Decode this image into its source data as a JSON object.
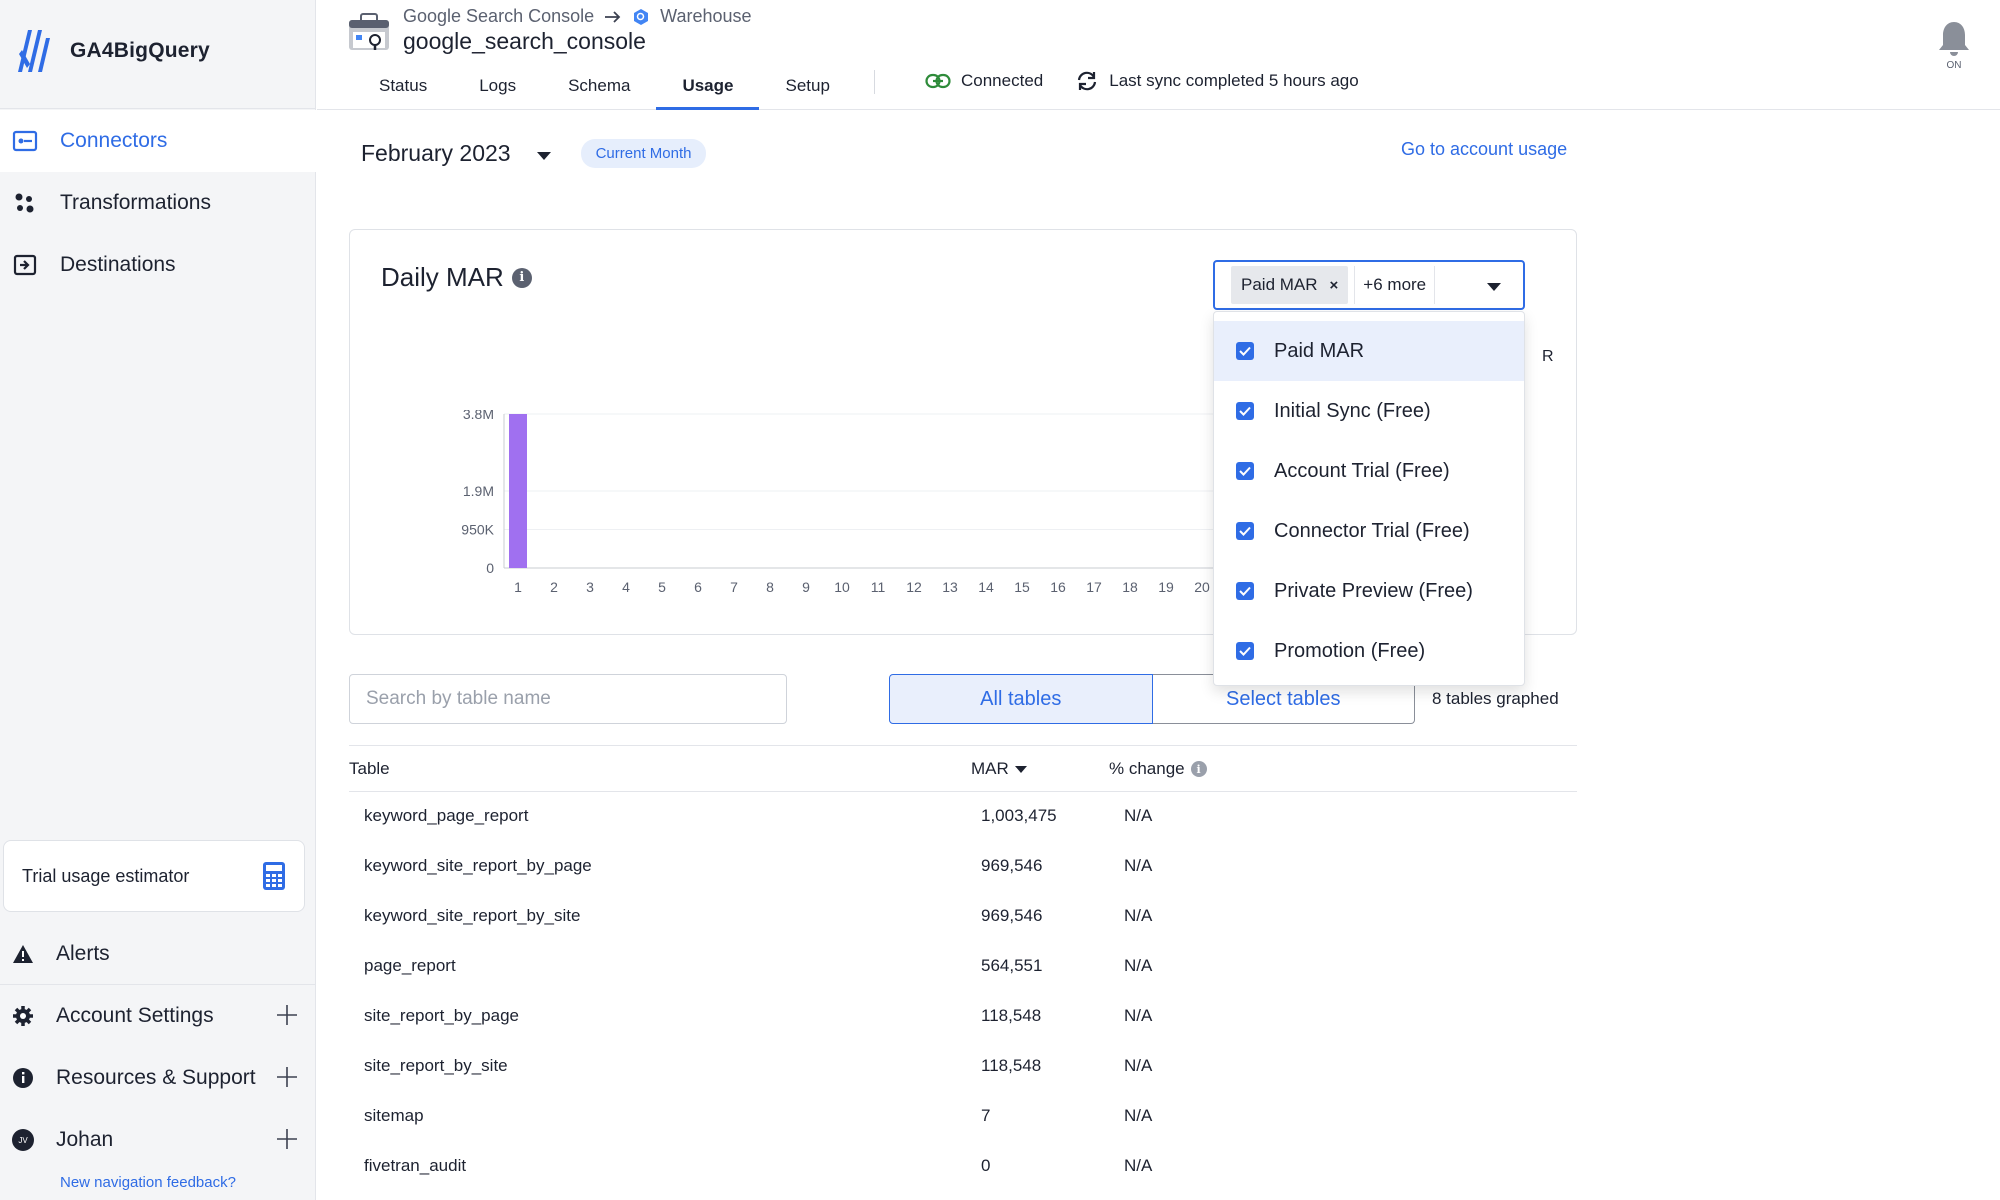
{
  "app": {
    "name": "GA4BigQuery"
  },
  "sidebar": {
    "nav": [
      {
        "label": "Connectors",
        "icon": "connectors-icon",
        "active": true
      },
      {
        "label": "Transformations",
        "icon": "transformations-icon",
        "active": false
      },
      {
        "label": "Destinations",
        "icon": "destinations-icon",
        "active": false
      }
    ],
    "estimator_label": "Trial usage estimator",
    "alerts": "Alerts",
    "account_settings": "Account Settings",
    "resources": "Resources & Support",
    "user": "Johan",
    "user_initials": "JV",
    "feedback": "New navigation feedback?"
  },
  "header": {
    "breadcrumb_source": "Google Search Console",
    "breadcrumb_dest": "Warehouse",
    "connector_name": "google_search_console",
    "tabs": [
      "Status",
      "Logs",
      "Schema",
      "Usage",
      "Setup"
    ],
    "active_tab": "Usage",
    "status_connected": "Connected",
    "status_sync": "Last sync completed 5 hours ago",
    "bell_label": "ON"
  },
  "usage": {
    "month": "February 2023",
    "month_badge": "Current Month",
    "account_link": "Go to account usage",
    "card_title": "Daily MAR",
    "legend_clip": "R"
  },
  "filter": {
    "chip": "Paid MAR",
    "more": "+6 more",
    "options": [
      {
        "label": "Paid MAR",
        "checked": true
      },
      {
        "label": "Initial Sync (Free)",
        "checked": true
      },
      {
        "label": "Account Trial (Free)",
        "checked": true
      },
      {
        "label": "Connector Trial (Free)",
        "checked": true
      },
      {
        "label": "Private Preview (Free)",
        "checked": true
      },
      {
        "label": "Promotion (Free)",
        "checked": true
      }
    ]
  },
  "chart_data": {
    "type": "bar",
    "title": "Daily MAR",
    "xlabel": "",
    "ylabel": "",
    "categories": [
      "1",
      "2",
      "3",
      "4",
      "5",
      "6",
      "7",
      "8",
      "9",
      "10",
      "11",
      "12",
      "13",
      "14",
      "15",
      "16",
      "17",
      "18",
      "19",
      "20"
    ],
    "series": [
      {
        "values": [
          3800000,
          0,
          0,
          0,
          0,
          0,
          0,
          0,
          0,
          0,
          0,
          0,
          0,
          0,
          0,
          0,
          0,
          0,
          0,
          0
        ],
        "color": "#a070f0"
      }
    ],
    "y_ticks": [
      {
        "value": 0,
        "label": "0"
      },
      {
        "value": 950000,
        "label": "950K"
      },
      {
        "value": 1900000,
        "label": "1.9M"
      },
      {
        "value": 3800000,
        "label": "3.8M"
      }
    ],
    "x_tick_labels": [
      "1",
      "2",
      "3",
      "4",
      "5",
      "6",
      "7",
      "8",
      "9",
      "10",
      "11",
      "12",
      "13",
      "14",
      "15",
      "16",
      "17",
      "18",
      "19",
      "20"
    ],
    "ylim": [
      0,
      3800000
    ],
    "grid": true
  },
  "table": {
    "search_placeholder": "Search by table name",
    "toggle_all": "All tables",
    "toggle_select": "Select tables",
    "graphed": "8 tables graphed",
    "headers": {
      "table": "Table",
      "mar": "MAR",
      "change": "% change"
    },
    "rows": [
      {
        "name": "keyword_page_report",
        "mar": "1,003,475",
        "change": "N/A"
      },
      {
        "name": "keyword_site_report_by_page",
        "mar": "969,546",
        "change": "N/A"
      },
      {
        "name": "keyword_site_report_by_site",
        "mar": "969,546",
        "change": "N/A"
      },
      {
        "name": "page_report",
        "mar": "564,551",
        "change": "N/A"
      },
      {
        "name": "site_report_by_page",
        "mar": "118,548",
        "change": "N/A"
      },
      {
        "name": "site_report_by_site",
        "mar": "118,548",
        "change": "N/A"
      },
      {
        "name": "sitemap",
        "mar": "7",
        "change": "N/A"
      },
      {
        "name": "fivetran_audit",
        "mar": "0",
        "change": "N/A"
      }
    ]
  },
  "colors": {
    "accent": "#2f6ce5",
    "bar": "#a070f0",
    "connected": "#2e8b3a"
  }
}
